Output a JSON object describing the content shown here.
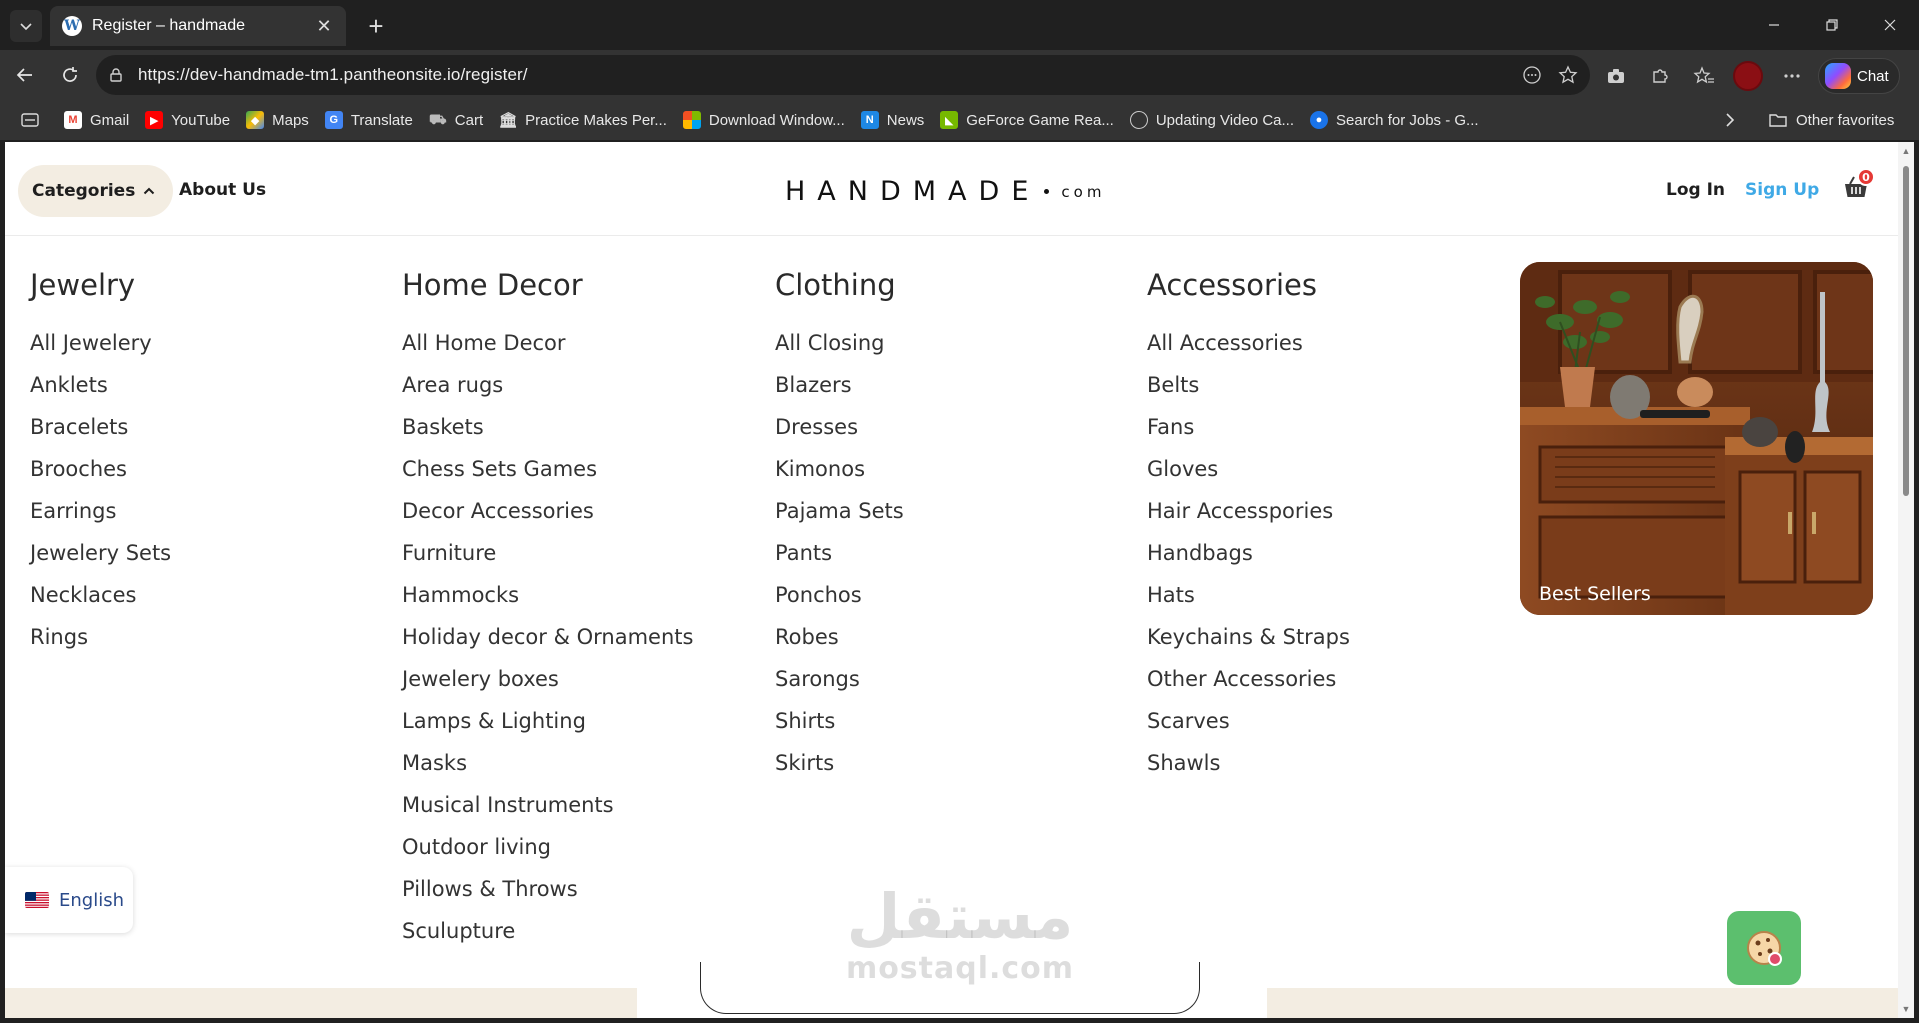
{
  "browser": {
    "tab_title": "Register – handmade",
    "url": "https://dev-handmade-tm1.pantheonsite.io/register/",
    "chat_label": "Chat",
    "bookmarks": [
      {
        "label": "Gmail",
        "icon": "gmail-icon",
        "color": "#ea4335"
      },
      {
        "label": "YouTube",
        "icon": "youtube-icon",
        "color": "#ff0000"
      },
      {
        "label": "Maps",
        "icon": "maps-icon",
        "color": "#34a853"
      },
      {
        "label": "Translate",
        "icon": "translate-icon",
        "color": "#4285f4"
      },
      {
        "label": "Cart",
        "icon": "cart-icon",
        "color": "#9e9e9e"
      },
      {
        "label": "Practice Makes Per...",
        "icon": "institution-icon",
        "color": "#dddddd"
      },
      {
        "label": "Download Window...",
        "icon": "windows-icon",
        "color": "#f25022"
      },
      {
        "label": "News",
        "icon": "news-icon",
        "color": "#1e88e5"
      },
      {
        "label": "GeForce Game Rea...",
        "icon": "nvidia-icon",
        "color": "#76b900"
      },
      {
        "label": "Updating Video Ca...",
        "icon": "globe-icon",
        "color": "#cccccc"
      },
      {
        "label": "Search for Jobs - G...",
        "icon": "jobs-icon",
        "color": "#1a73e8"
      }
    ],
    "other_favorites": "Other favorites"
  },
  "header": {
    "categories_label": "Categories",
    "about_label": "About Us",
    "logo_main": "HANDMADE",
    "logo_suffix": "com",
    "login_label": "Log In",
    "signup_label": "Sign Up",
    "cart_count": "0",
    "accent_color": "#3fa9e6"
  },
  "menu": {
    "columns": [
      {
        "heading": "Jewelry",
        "items": [
          "All Jewelery",
          "Anklets",
          "Bracelets",
          "Brooches",
          "Earrings",
          "Jewelery Sets",
          "Necklaces",
          "Rings"
        ]
      },
      {
        "heading": "Home Decor",
        "items": [
          "All Home Decor",
          "Area rugs",
          "Baskets",
          "Chess Sets Games",
          "Decor Accessories",
          "Furniture",
          "Hammocks",
          "Holiday decor & Ornaments",
          "Jewelery boxes",
          "Lamps & Lighting",
          "Masks",
          "Musical Instruments",
          "Outdoor living",
          "Pillows & Throws",
          "Sculupture"
        ]
      },
      {
        "heading": "Clothing",
        "items": [
          "All Closing",
          "Blazers",
          "Dresses",
          "Kimonos",
          "Pajama Sets",
          "Pants",
          "Ponchos",
          "Robes",
          "Sarongs",
          "Shirts",
          "Skirts"
        ]
      },
      {
        "heading": "Accessories",
        "items": [
          "All Accessories",
          "Belts",
          "Fans",
          "Gloves",
          "Hair Accesspories",
          "Handbags",
          "Hats",
          "Keychains & Straps",
          "Other Accessories",
          "Scarves",
          "Shawls"
        ]
      }
    ],
    "promo_label": "Best Sellers"
  },
  "language": {
    "label": "English"
  },
  "watermark": {
    "arabic": "مستقل",
    "latin": "mostaql.com"
  }
}
